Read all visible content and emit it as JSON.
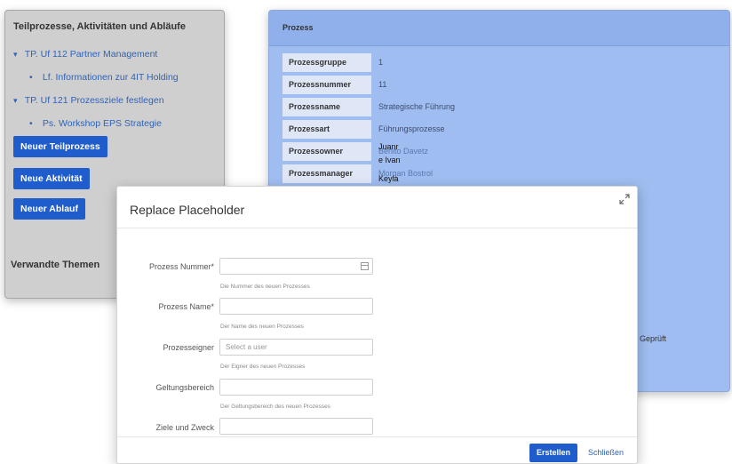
{
  "left_panel": {
    "title": "Teilprozesse, Aktivitäten und Abläufe",
    "tree": [
      {
        "label": "TP. Uf 112 Partner Management"
      },
      {
        "label": "Lf. Informationen zur 4IT Holding"
      },
      {
        "label": "TP. Uf 121 Prozessziele festlegen"
      },
      {
        "label": "Ps. Workshop EPS Strategie"
      }
    ],
    "buttons": {
      "new_subprocess": "Neuer Teilprozess",
      "new_activity": "Neue Aktivität",
      "new_flow": "Neuer Ablauf"
    },
    "related_topics": "Verwandte Themen"
  },
  "right_panel": {
    "header": "Prozess",
    "rows": [
      {
        "label": "Prozessgruppe",
        "value": "1"
      },
      {
        "label": "Prozessnummer",
        "value": "11"
      },
      {
        "label": "Prozessname",
        "value": "Strategische Führung"
      },
      {
        "label": "Prozessart",
        "value": "Führungsprozesse"
      },
      {
        "label": "Prozessowner",
        "value": "Benito Davetz"
      },
      {
        "label": "Prozessmanager",
        "value": "Morgan Bostrol"
      }
    ],
    "suggestions": [
      "Juanr",
      "e Ivan",
      "Keyla"
    ],
    "status": "Geprüft"
  },
  "modal": {
    "title": "Replace Placeholder",
    "fields": [
      {
        "label": "Prozess Nummer*",
        "placeholder": "",
        "help": "Die Nummer des neuen Prozesses"
      },
      {
        "label": "Prozess Name*",
        "placeholder": "",
        "help": "Der Name des neuen Prozesses"
      },
      {
        "label": "Prozesseigner",
        "placeholder": "Select a user",
        "help": "Der Eigner des neuen Prozesses"
      },
      {
        "label": "Geltungsbereich",
        "placeholder": "",
        "help": "Der Geltungsbereich des neuen Prozesses"
      },
      {
        "label": "Ziele und Zweck",
        "placeholder": "",
        "help": ""
      }
    ],
    "buttons": {
      "create": "Erstellen",
      "close": "Schließen"
    }
  },
  "icons": {
    "expand": "expand-icon",
    "calendar": "calendar-icon",
    "caret": "caret-down-icon",
    "bullet": "bullet-icon"
  },
  "colors": {
    "primary_button": "#1f5ccc",
    "link": "#2f63b8",
    "panel_bg": "#9fbdf0"
  }
}
